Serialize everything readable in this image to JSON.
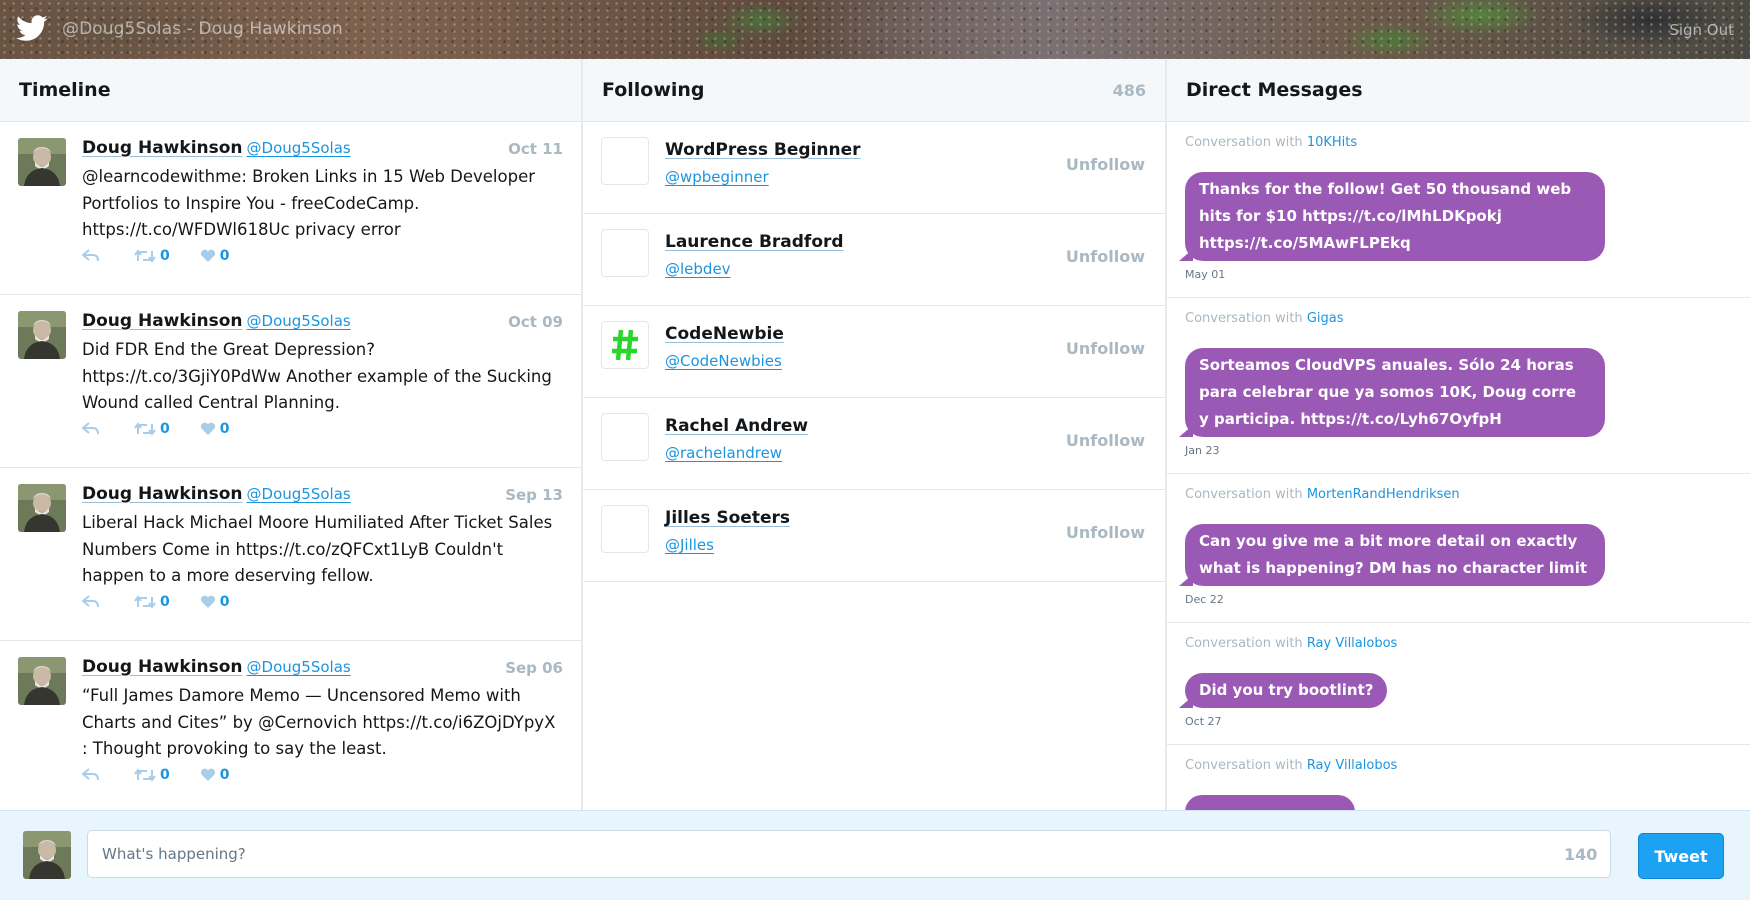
{
  "header": {
    "title": "@Doug5Solas - Doug Hawkinson",
    "signout_label": "Sign Out",
    "logo_icon": "twitter-bird-icon"
  },
  "colors": {
    "twitter_blue": "#1da1f2",
    "link_blue": "#1b95e0",
    "dm_purple": "#9b59b6",
    "muted_gray": "#aab8c2"
  },
  "timeline": {
    "title": "Timeline",
    "tweets": [
      {
        "name": "Doug Hawkinson",
        "handle": "@Doug5Solas",
        "date": "Oct 11",
        "text": "@learncodewithme: Broken Links in 15 Web Developer Portfolios to Inspire You - freeCodeCamp. https://t.co/WFDWl618Uc privacy error",
        "retweets": "0",
        "likes": "0"
      },
      {
        "name": "Doug Hawkinson",
        "handle": "@Doug5Solas",
        "date": "Oct 09",
        "text": "Did FDR End the Great Depression? https://t.co/3GjiY0PdWw Another example of the Sucking Wound called Central Planning.",
        "retweets": "0",
        "likes": "0"
      },
      {
        "name": "Doug Hawkinson",
        "handle": "@Doug5Solas",
        "date": "Sep 13",
        "text": "Liberal Hack Michael Moore Humiliated After Ticket Sales Numbers Come in https://t.co/zQFCxt1LyB Couldn't happen to a more deserving fellow.",
        "retweets": "0",
        "likes": "0"
      },
      {
        "name": "Doug Hawkinson",
        "handle": "@Doug5Solas",
        "date": "Sep 06",
        "text": "“Full James Damore Memo — Uncensored Memo with Charts and Cites” by @Cernovich https://t.co/i6ZOjDYpyX : Thought provoking to say the least.",
        "retweets": "0",
        "likes": "0"
      }
    ]
  },
  "following": {
    "title": "Following",
    "count": "486",
    "unfollow_label": "Unfollow",
    "users": [
      {
        "name": "WordPress Beginner",
        "handle": "@wpbeginner"
      },
      {
        "name": "Laurence Bradford",
        "handle": "@lebdev"
      },
      {
        "name": "CodeNewbie",
        "handle": "@CodeNewbies"
      },
      {
        "name": "Rachel Andrew",
        "handle": "@rachelandrew"
      },
      {
        "name": "Jilles Soeters",
        "handle": "@Jilles"
      }
    ]
  },
  "dms": {
    "title": "Direct Messages",
    "conv_prefix": "Conversation with",
    "conversations": [
      {
        "user": "10KHits",
        "message": "Thanks for the follow! Get 50 thousand web hits for $10 https://t.co/lMhLDKpokj https://t.co/5MAwFLPEkq",
        "date": "May 01"
      },
      {
        "user": "Gigas",
        "message": "Sorteamos CloudVPS anuales. Sólo 24 horas para celebrar que ya somos 10K, Doug corre y participa. https://t.co/Lyh67OyfpH",
        "date": "Jan 23"
      },
      {
        "user": "MortenRandHendriksen",
        "message": "Can you give me a bit more detail on exactly what is happening? DM has no character limit",
        "date": "Dec 22"
      },
      {
        "user": "Ray Villalobos",
        "message": "Did you try bootlint?",
        "date": "Oct 27"
      },
      {
        "user": "Ray Villalobos"
      }
    ]
  },
  "composer": {
    "placeholder": "What's happening?",
    "char_count": "140",
    "tweet_label": "Tweet"
  }
}
